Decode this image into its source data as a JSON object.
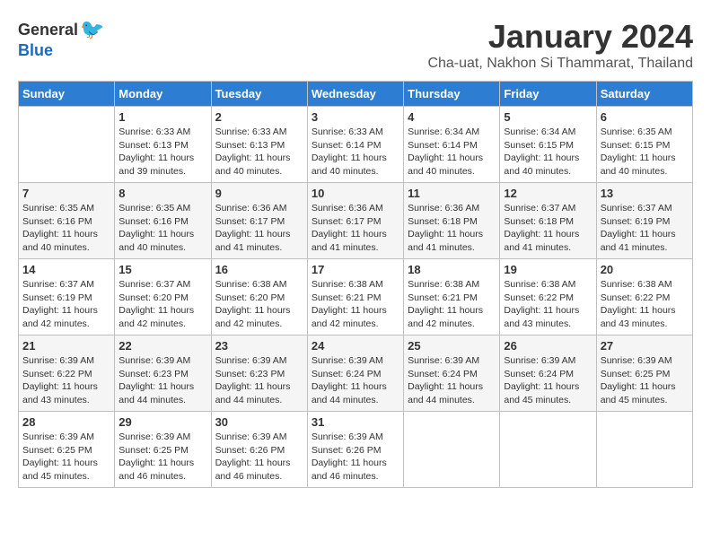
{
  "logo": {
    "general": "General",
    "blue": "Blue"
  },
  "title": "January 2024",
  "location": "Cha-uat, Nakhon Si Thammarat, Thailand",
  "columns": [
    "Sunday",
    "Monday",
    "Tuesday",
    "Wednesday",
    "Thursday",
    "Friday",
    "Saturday"
  ],
  "weeks": [
    [
      {
        "day": "",
        "info": ""
      },
      {
        "day": "1",
        "info": "Sunrise: 6:33 AM\nSunset: 6:13 PM\nDaylight: 11 hours\nand 39 minutes."
      },
      {
        "day": "2",
        "info": "Sunrise: 6:33 AM\nSunset: 6:13 PM\nDaylight: 11 hours\nand 40 minutes."
      },
      {
        "day": "3",
        "info": "Sunrise: 6:33 AM\nSunset: 6:14 PM\nDaylight: 11 hours\nand 40 minutes."
      },
      {
        "day": "4",
        "info": "Sunrise: 6:34 AM\nSunset: 6:14 PM\nDaylight: 11 hours\nand 40 minutes."
      },
      {
        "day": "5",
        "info": "Sunrise: 6:34 AM\nSunset: 6:15 PM\nDaylight: 11 hours\nand 40 minutes."
      },
      {
        "day": "6",
        "info": "Sunrise: 6:35 AM\nSunset: 6:15 PM\nDaylight: 11 hours\nand 40 minutes."
      }
    ],
    [
      {
        "day": "7",
        "info": "Sunrise: 6:35 AM\nSunset: 6:16 PM\nDaylight: 11 hours\nand 40 minutes."
      },
      {
        "day": "8",
        "info": "Sunrise: 6:35 AM\nSunset: 6:16 PM\nDaylight: 11 hours\nand 40 minutes."
      },
      {
        "day": "9",
        "info": "Sunrise: 6:36 AM\nSunset: 6:17 PM\nDaylight: 11 hours\nand 41 minutes."
      },
      {
        "day": "10",
        "info": "Sunrise: 6:36 AM\nSunset: 6:17 PM\nDaylight: 11 hours\nand 41 minutes."
      },
      {
        "day": "11",
        "info": "Sunrise: 6:36 AM\nSunset: 6:18 PM\nDaylight: 11 hours\nand 41 minutes."
      },
      {
        "day": "12",
        "info": "Sunrise: 6:37 AM\nSunset: 6:18 PM\nDaylight: 11 hours\nand 41 minutes."
      },
      {
        "day": "13",
        "info": "Sunrise: 6:37 AM\nSunset: 6:19 PM\nDaylight: 11 hours\nand 41 minutes."
      }
    ],
    [
      {
        "day": "14",
        "info": "Sunrise: 6:37 AM\nSunset: 6:19 PM\nDaylight: 11 hours\nand 42 minutes."
      },
      {
        "day": "15",
        "info": "Sunrise: 6:37 AM\nSunset: 6:20 PM\nDaylight: 11 hours\nand 42 minutes."
      },
      {
        "day": "16",
        "info": "Sunrise: 6:38 AM\nSunset: 6:20 PM\nDaylight: 11 hours\nand 42 minutes."
      },
      {
        "day": "17",
        "info": "Sunrise: 6:38 AM\nSunset: 6:21 PM\nDaylight: 11 hours\nand 42 minutes."
      },
      {
        "day": "18",
        "info": "Sunrise: 6:38 AM\nSunset: 6:21 PM\nDaylight: 11 hours\nand 42 minutes."
      },
      {
        "day": "19",
        "info": "Sunrise: 6:38 AM\nSunset: 6:22 PM\nDaylight: 11 hours\nand 43 minutes."
      },
      {
        "day": "20",
        "info": "Sunrise: 6:38 AM\nSunset: 6:22 PM\nDaylight: 11 hours\nand 43 minutes."
      }
    ],
    [
      {
        "day": "21",
        "info": "Sunrise: 6:39 AM\nSunset: 6:22 PM\nDaylight: 11 hours\nand 43 minutes."
      },
      {
        "day": "22",
        "info": "Sunrise: 6:39 AM\nSunset: 6:23 PM\nDaylight: 11 hours\nand 44 minutes."
      },
      {
        "day": "23",
        "info": "Sunrise: 6:39 AM\nSunset: 6:23 PM\nDaylight: 11 hours\nand 44 minutes."
      },
      {
        "day": "24",
        "info": "Sunrise: 6:39 AM\nSunset: 6:24 PM\nDaylight: 11 hours\nand 44 minutes."
      },
      {
        "day": "25",
        "info": "Sunrise: 6:39 AM\nSunset: 6:24 PM\nDaylight: 11 hours\nand 44 minutes."
      },
      {
        "day": "26",
        "info": "Sunrise: 6:39 AM\nSunset: 6:24 PM\nDaylight: 11 hours\nand 45 minutes."
      },
      {
        "day": "27",
        "info": "Sunrise: 6:39 AM\nSunset: 6:25 PM\nDaylight: 11 hours\nand 45 minutes."
      }
    ],
    [
      {
        "day": "28",
        "info": "Sunrise: 6:39 AM\nSunset: 6:25 PM\nDaylight: 11 hours\nand 45 minutes."
      },
      {
        "day": "29",
        "info": "Sunrise: 6:39 AM\nSunset: 6:25 PM\nDaylight: 11 hours\nand 46 minutes."
      },
      {
        "day": "30",
        "info": "Sunrise: 6:39 AM\nSunset: 6:26 PM\nDaylight: 11 hours\nand 46 minutes."
      },
      {
        "day": "31",
        "info": "Sunrise: 6:39 AM\nSunset: 6:26 PM\nDaylight: 11 hours\nand 46 minutes."
      },
      {
        "day": "",
        "info": ""
      },
      {
        "day": "",
        "info": ""
      },
      {
        "day": "",
        "info": ""
      }
    ]
  ]
}
